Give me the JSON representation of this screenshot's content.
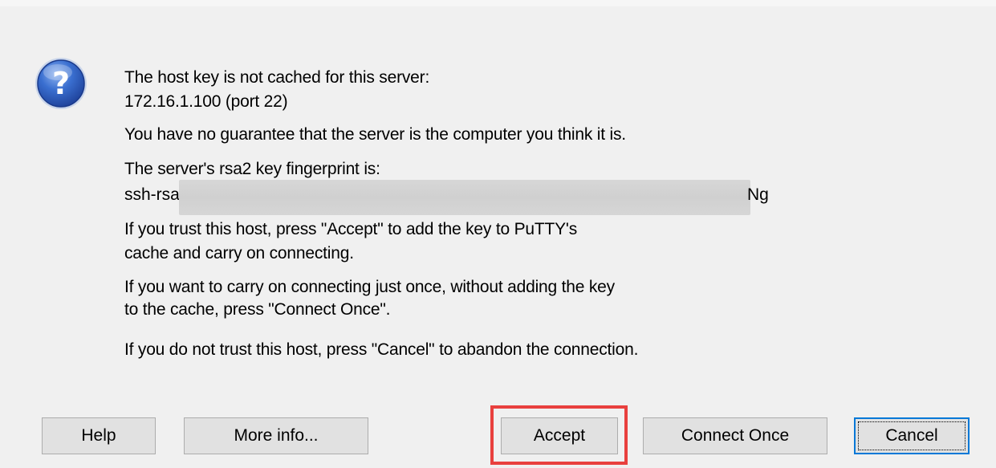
{
  "dialog": {
    "icon": "question-icon",
    "accent_color": "#0078d7",
    "highlight_color": "#e8403e",
    "message": {
      "line1": "The host key is not cached for this server:",
      "line2": "172.16.1.100 (port 22)",
      "line3": "You have no guarantee that the server is the computer you think it is.",
      "line4": "The server's rsa2 key fingerprint is:",
      "fingerprint_prefix": "ssh-rsa",
      "fingerprint_suffix": "Ng",
      "line5": "If you trust this host, press \"Accept\" to add the key to PuTTY's",
      "line6": "cache and carry on connecting.",
      "line7": "If you want to carry on connecting just once, without adding the key",
      "line8": "to the cache, press \"Connect Once\".",
      "line9": "If you do not trust this host, press \"Cancel\" to abandon the connection."
    },
    "buttons": {
      "help": "Help",
      "more_info": "More info...",
      "accept": "Accept",
      "connect_once": "Connect Once",
      "cancel": "Cancel"
    }
  }
}
